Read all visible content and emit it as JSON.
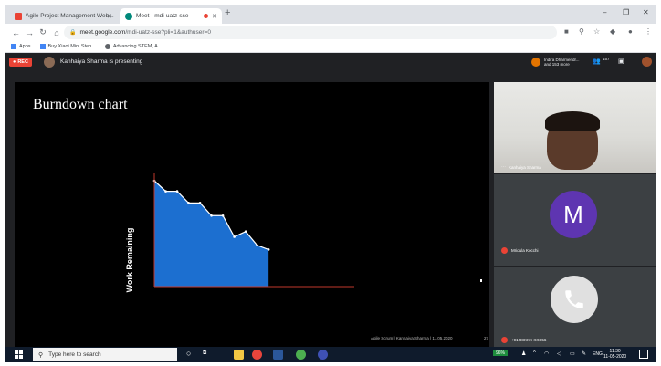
{
  "browser": {
    "tabs": [
      {
        "label": "Agile Project Management Web...",
        "favicon_color": "#ea4335"
      },
      {
        "label": "Meet - mdi-uatz-sse",
        "favicon_color": "#00897b"
      }
    ],
    "new_tab": "+",
    "window_controls": [
      "–",
      "❐",
      "✕"
    ],
    "url_host": "meet.google.com",
    "url_path": "/mdi-uatz-sse?pli=1&authuser=0",
    "bookmarks": [
      {
        "label": "Apps",
        "color": "#4285f4"
      },
      {
        "label": "Buy Xiaoi Mini Step...",
        "color": "#4285f4"
      },
      {
        "label": "Advancing STEM, A...",
        "color": "#5f6368"
      }
    ]
  },
  "meet": {
    "rec_label": "REC",
    "presenting_text": "Kanhaiya Sharma is presenting",
    "participants_chip_line1": "Indira Dharmendr...",
    "participants_chip_line2": "and 153 more",
    "participants_count": "157"
  },
  "slide": {
    "title": "Burndown chart",
    "footer": "Agile Scrum  |  Kanhaiya Sharma  |  11.05.2020",
    "page_number": "27"
  },
  "chart_data": {
    "type": "area",
    "title": "",
    "xlabel": "",
    "ylabel": "Work Remaining",
    "x": [
      0,
      1,
      2,
      3,
      4,
      5,
      6,
      7,
      8,
      9,
      10
    ],
    "values": [
      100,
      90,
      90,
      79,
      79,
      67,
      67,
      47,
      52,
      39,
      35
    ],
    "xlim": [
      0,
      17.5
    ],
    "ylim": [
      0,
      100
    ],
    "fill_color": "#1c6fd0",
    "axis_color": "#c0392b",
    "grid": false
  },
  "tiles": [
    {
      "name": "Kanhaiya Sharma"
    },
    {
      "name": "Mridula Kocchi",
      "initial": "M",
      "avatar_color": "#5e35b1"
    },
    {
      "name": "+91 98XXX-XXX56"
    }
  ],
  "taskbar": {
    "search_placeholder": "Type here to search",
    "lang": "ENG",
    "time": "11:30",
    "date": "11-05-2020",
    "battery": "96%"
  }
}
